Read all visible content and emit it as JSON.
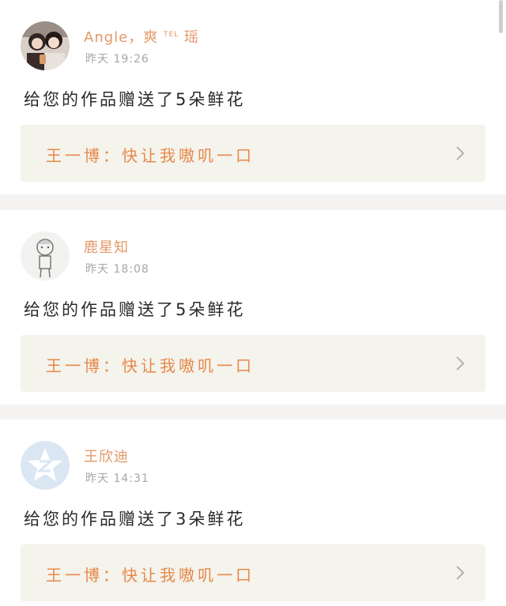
{
  "notifications": [
    {
      "username": "Angle，爽",
      "username_sup": "TEL",
      "username_tail": "瑶",
      "time": "昨天 19:26",
      "message": "给您的作品赠送了5朵鲜花",
      "work_title": "王一博：快让我嗷叽一口"
    },
    {
      "username": "鹿星知",
      "username_sup": "",
      "username_tail": "",
      "time": "昨天 18:08",
      "message": "给您的作品赠送了5朵鲜花",
      "work_title": "王一博：快让我嗷叽一口"
    },
    {
      "username": "王欣迪",
      "username_sup": "",
      "username_tail": "",
      "time": "昨天 14:31",
      "message": "给您的作品赠送了3朵鲜花",
      "work_title": "王一博：快让我嗷叽一口"
    }
  ],
  "icons": {
    "chevron": "chevron-right-icon",
    "default_avatar": "qzone-default-avatar-icon"
  },
  "colors": {
    "username": "#e49868",
    "link_text": "#e8884a",
    "link_bg": "#f4f3ec",
    "separator": "#f5f3f2"
  }
}
